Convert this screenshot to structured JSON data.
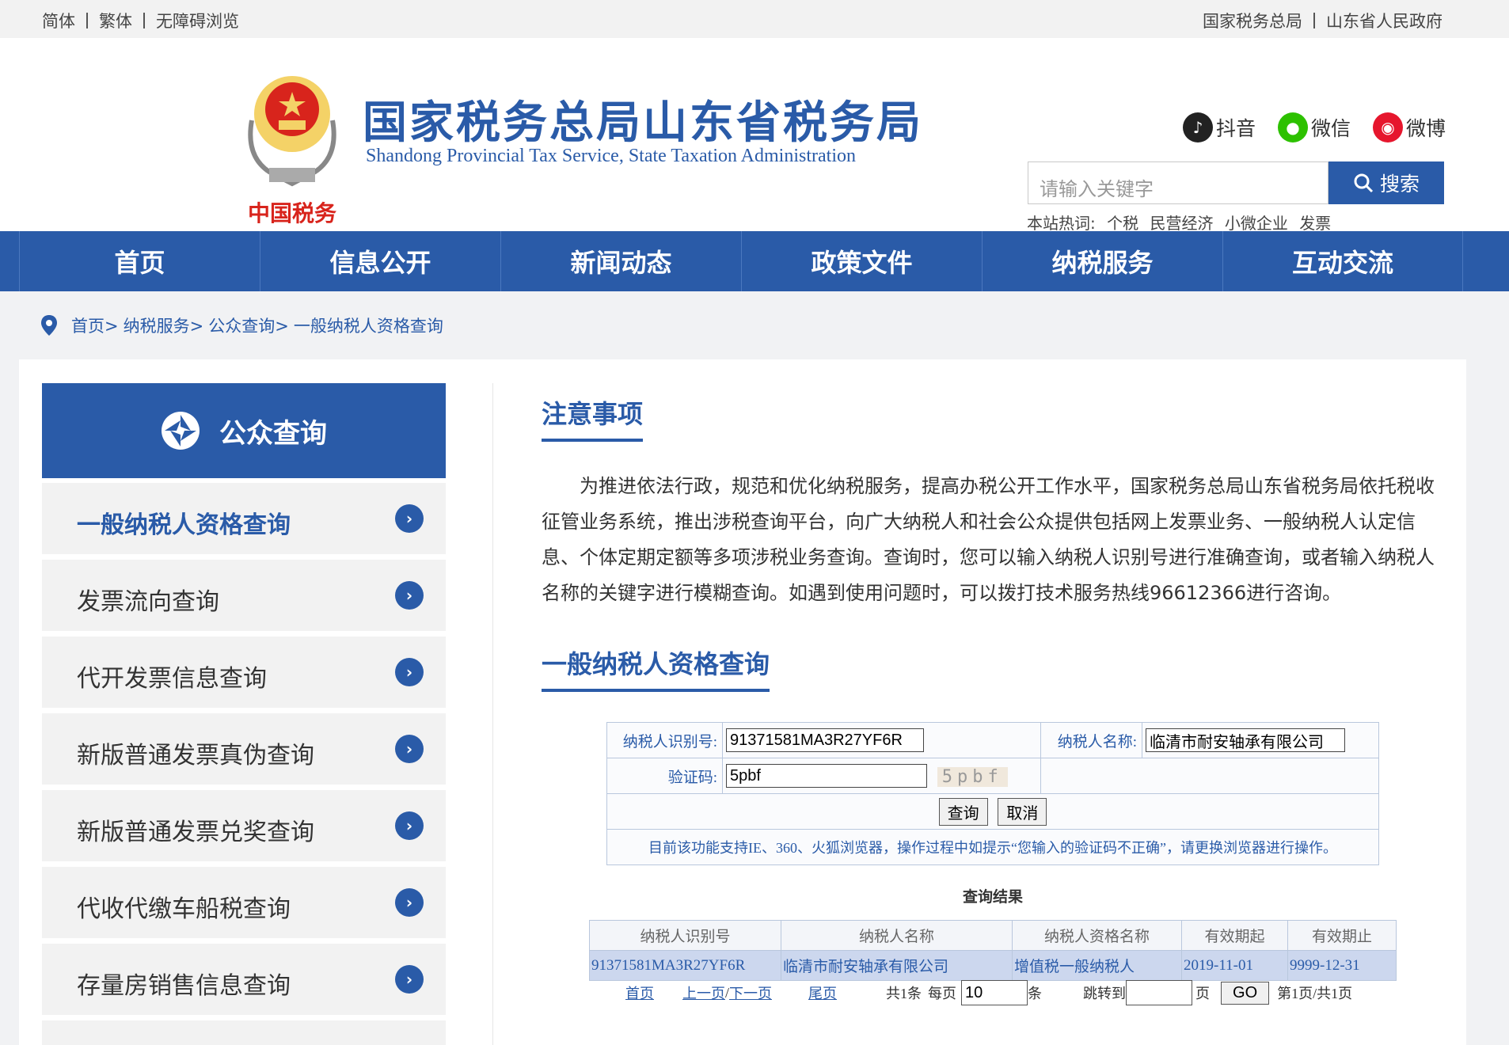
{
  "topbar": {
    "left": [
      "简体",
      "繁体",
      "无障碍浏览"
    ],
    "right": [
      "国家税务总局",
      "山东省人民政府"
    ]
  },
  "header": {
    "title": "国家税务总局山东省税务局",
    "subtitle": "Shandong Provincial Tax Service, State Taxation Administration",
    "emblem_text": "中国税务",
    "social": [
      {
        "label": "抖音",
        "icon": "douyin-icon",
        "color": "#222222"
      },
      {
        "label": "微信",
        "icon": "wechat-icon",
        "color": "#2dc100"
      },
      {
        "label": "微博",
        "icon": "weibo-icon",
        "color": "#e6162d"
      }
    ],
    "search_placeholder": "请输入关键字",
    "search_button": "搜索",
    "hotwords_label": "本站热词:",
    "hotwords": [
      "个税",
      "民营经济",
      "小微企业",
      "发票"
    ]
  },
  "nav": [
    "首页",
    "信息公开",
    "新闻动态",
    "政策文件",
    "纳税服务",
    "互动交流"
  ],
  "breadcrumb": [
    "首页>",
    "纳税服务>",
    "公众查询>",
    "一般纳税人资格查询"
  ],
  "sidebar": {
    "title": "公众查询",
    "items": [
      {
        "label": "一般纳税人资格查询",
        "active": true
      },
      {
        "label": "发票流向查询",
        "active": false
      },
      {
        "label": "代开发票信息查询",
        "active": false
      },
      {
        "label": "新版普通发票真伪查询",
        "active": false
      },
      {
        "label": "新版普通发票兑奖查询",
        "active": false
      },
      {
        "label": "代收代缴车船税查询",
        "active": false
      },
      {
        "label": "存量房销售信息查询",
        "active": false
      }
    ]
  },
  "notice": {
    "title": "注意事项",
    "body": "为推进依法行政，规范和优化纳税服务，提高办税公开工作水平，国家税务总局山东省税务局依托税收征管业务系统，推出涉税查询平台，向广大纳税人和社会公众提供包括网上发票业务、一般纳税人认定信息、个体定期定额等多项涉税业务查询。查询时，您可以输入纳税人识别号进行准确查询，或者输入纳税人名称的关键字进行模糊查询。如遇到使用问题时，可以拨打技术服务热线96612366进行咨询。"
  },
  "query": {
    "title": "一般纳税人资格查询",
    "id_label": "纳税人识别号:",
    "id_value": "91371581MA3R27YF6R",
    "name_label": "纳税人名称:",
    "name_value": "临清市耐安轴承有限公司",
    "captcha_label": "验证码:",
    "captcha_value": "5pbf",
    "captcha_image": "5pbf",
    "query_button": "查询",
    "cancel_button": "取消",
    "note": "目前该功能支持IE、360、火狐浏览器，操作过程中如提示“您输入的验证码不正确”，请更换浏览器进行操作。"
  },
  "results": {
    "title": "查询结果",
    "columns": [
      "纳税人识别号",
      "纳税人名称",
      "纳税人资格名称",
      "有效期起",
      "有效期止"
    ],
    "rows": [
      [
        "91371581MA3R27YF6R",
        "临清市耐安轴承有限公司",
        "增值税一般纳税人",
        "2019-11-01",
        "9999-12-31"
      ]
    ],
    "pager": {
      "first": "首页",
      "prev": "上一页",
      "slash": "/",
      "next": "下一页",
      "last": "尾页",
      "total": "共1条",
      "per_page_label": "每页",
      "per_page_value": "10",
      "per_page_unit": "条",
      "jump_label": "跳转到",
      "jump_unit": "页",
      "go": "GO",
      "page_info": "第1页/共1页"
    }
  }
}
